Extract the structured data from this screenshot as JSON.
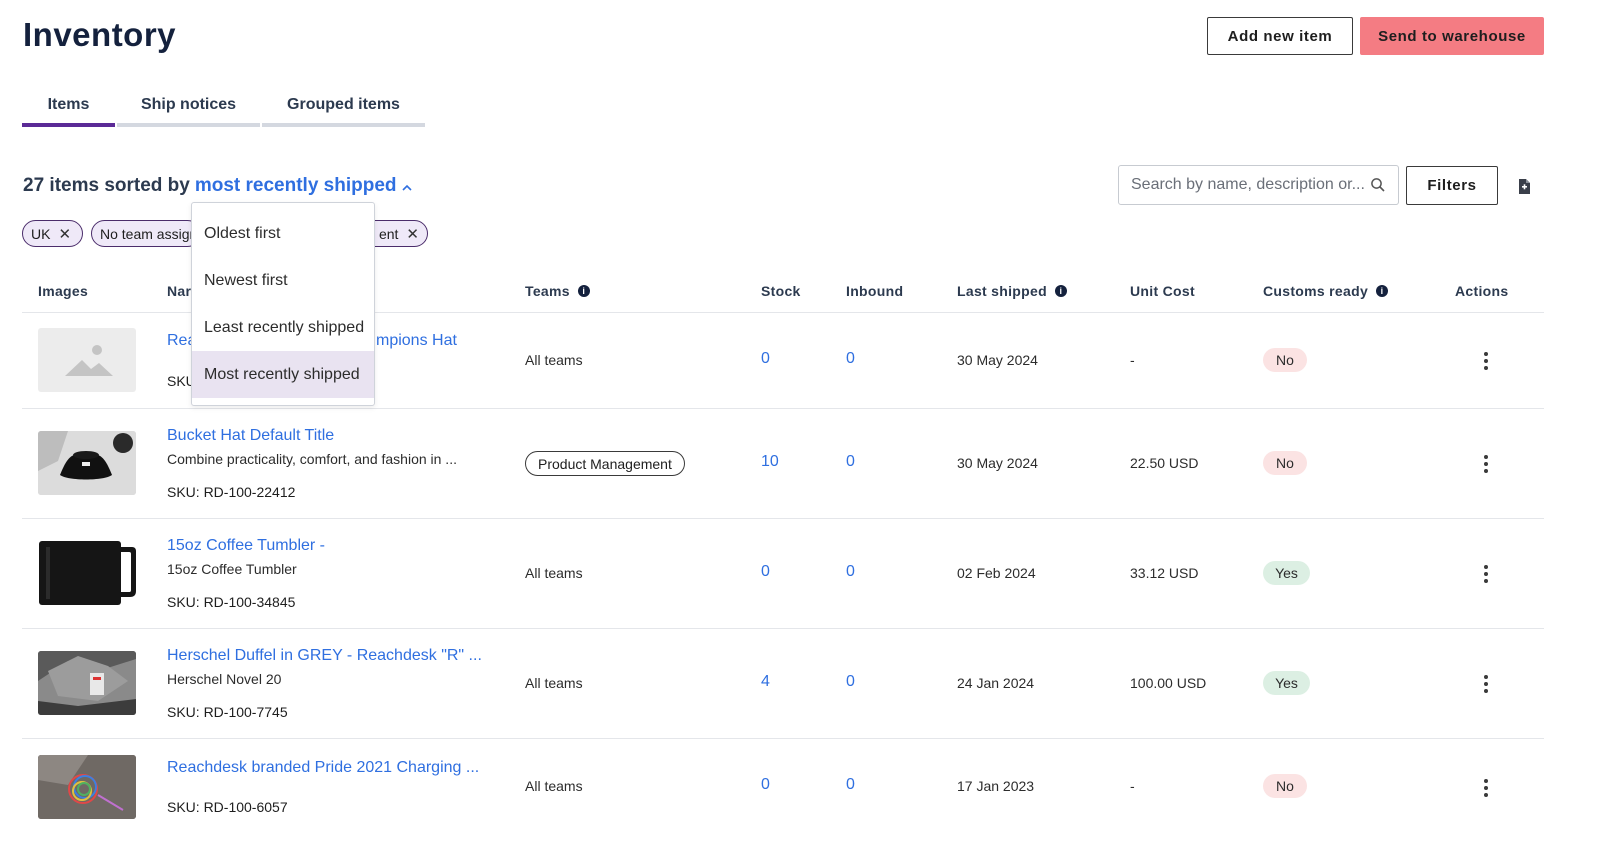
{
  "header": {
    "title": "Inventory",
    "add_button": "Add new item",
    "send_button": "Send to warehouse"
  },
  "tabs": [
    {
      "label": "Items",
      "active": true
    },
    {
      "label": "Ship notices",
      "active": false
    },
    {
      "label": "Grouped items",
      "active": false
    }
  ],
  "summary": {
    "prefix": "27 items sorted by",
    "sort_label": "most recently shipped"
  },
  "search": {
    "placeholder": "Search by name, description or..."
  },
  "filters_button": "Filters",
  "chips": [
    {
      "label": "UK"
    },
    {
      "label": "No team assigned"
    },
    {
      "label": "ent"
    }
  ],
  "sort_menu": {
    "options": [
      "Oldest first",
      "Newest first",
      "Least recently shipped",
      "Most recently shipped"
    ],
    "selected": "Most recently shipped"
  },
  "table": {
    "headers": {
      "images": "Images",
      "name": "Nar",
      "teams": "Teams",
      "stock": "Stock",
      "inbound": "Inbound",
      "last_shipped": "Last shipped",
      "unit_cost": "Unit Cost",
      "customs_ready": "Customs ready",
      "actions": "Actions"
    },
    "rows": [
      {
        "name": "Rea",
        "name_tail": "mpions Hat",
        "description": "",
        "sku": "SKU",
        "teams": "All teams",
        "team_badge": false,
        "stock": "0",
        "inbound": "0",
        "last_shipped": "30 May 2024",
        "unit_cost": "-",
        "customs_ready": "No",
        "image": "placeholder-image"
      },
      {
        "name": "Bucket Hat Default Title",
        "description": "Combine practicality, comfort, and fashion in ...",
        "sku": "SKU: RD-100-22412",
        "teams": "Product Management",
        "team_badge": true,
        "stock": "10",
        "inbound": "0",
        "last_shipped": "30 May 2024",
        "unit_cost": "22.50 USD",
        "customs_ready": "No",
        "image": "bucket-hat-photo"
      },
      {
        "name": "15oz Coffee Tumbler -",
        "description": "15oz Coffee Tumbler",
        "sku": "SKU: RD-100-34845",
        "teams": "All teams",
        "team_badge": false,
        "stock": "0",
        "inbound": "0",
        "last_shipped": "02 Feb 2024",
        "unit_cost": "33.12 USD",
        "customs_ready": "Yes",
        "image": "tumbler-photo"
      },
      {
        "name": "Herschel Duffel in GREY - Reachdesk \"R\" ...",
        "description": "Herschel Novel 20",
        "sku": "SKU: RD-100-7745",
        "teams": "All teams",
        "team_badge": false,
        "stock": "4",
        "inbound": "0",
        "last_shipped": "24 Jan 2024",
        "unit_cost": "100.00 USD",
        "customs_ready": "Yes",
        "image": "duffel-photo"
      },
      {
        "name": "Reachdesk branded Pride 2021 Charging ...",
        "description": "",
        "sku": "SKU: RD-100-6057",
        "teams": "All teams",
        "team_badge": false,
        "stock": "0",
        "inbound": "0",
        "last_shipped": "17 Jan 2023",
        "unit_cost": "-",
        "customs_ready": "No",
        "image": "charging-cable-photo"
      }
    ]
  },
  "colors": {
    "accent": "#2f6fe0",
    "primary_button": "#f47c83",
    "active_tab": "#5b2a96",
    "chip_bg": "#efe9f8",
    "no_pill": "#fbe3e3",
    "yes_pill": "#dcefe3"
  }
}
